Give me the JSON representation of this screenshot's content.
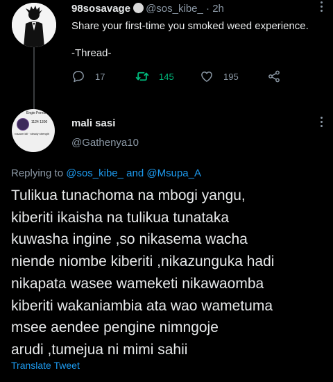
{
  "parent_tweet": {
    "author_name": "98sosavage",
    "handle": "@sos_kibe_",
    "separator": "·",
    "time": "2h",
    "text": "Share your first-time you smoked weed experience.",
    "thread_label": "-Thread-",
    "reply_count": "17",
    "retweet_count": "145",
    "like_count": "195",
    "icons": [
      "reply-icon",
      "retweet-icon",
      "like-icon",
      "share-icon"
    ],
    "retweet_color": "#00ba7c"
  },
  "reply_tweet": {
    "author_name": "mali sasi",
    "handle": "@Gathenya10",
    "avatar_text": {
      "name": "Engie Fernis",
      "stats": "1124  1300",
      "bio": "rosaum kill  ·  steady strength"
    },
    "replying_prefix": "Replying to",
    "replying_to_1": "@sos_kibe_",
    "replying_and": "and",
    "replying_to_2": "@Msupa_A",
    "body_lines": [
      "Tulikua tunachoma na mbogi yangu,",
      "kiberiti ikaisha na tulikua tunataka",
      "kuwasha ingine ,so nikasema wacha",
      "niende niombe kiberiti  ,nikazunguka hadi",
      "nikapata wasee wameketi nikawaomba",
      "kiberiti wakaniambia ata wao wametuma",
      "msee aendee pengine nimngoje",
      "arudi ,tumejua ni mimi sahii"
    ],
    "translate_label": "Translate Tweet"
  },
  "colors": {
    "background": "#000000",
    "text": "#e7e9ea",
    "muted": "#8b98a5",
    "link": "#1d9bf0"
  }
}
